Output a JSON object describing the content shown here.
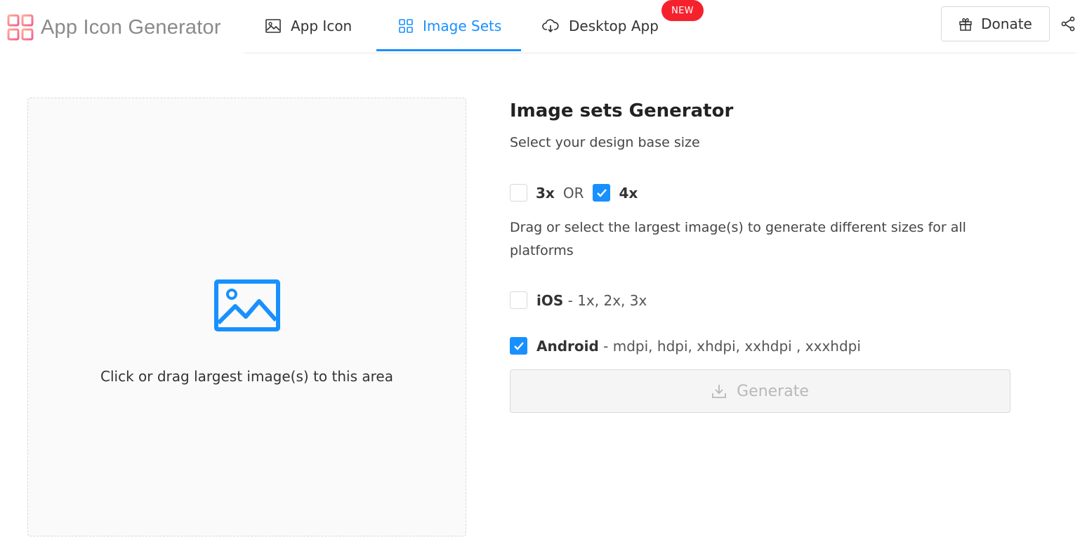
{
  "brand": {
    "name": "App Icon Generator",
    "logo_colors": [
      "#f06292",
      "#ff8a65"
    ]
  },
  "nav": {
    "tabs": [
      {
        "label": "App Icon",
        "icon": "image-icon",
        "active": false
      },
      {
        "label": "Image Sets",
        "icon": "grid-icon",
        "active": true
      },
      {
        "label": "Desktop App",
        "icon": "cloud-download-icon",
        "active": false
      }
    ],
    "badge": "NEW",
    "donate": "Donate",
    "share_icon": "share-icon"
  },
  "upload": {
    "icon": "picture-icon",
    "text": "Click or drag largest image(s) to this area"
  },
  "generator": {
    "title": "Image sets Generator",
    "subtitle": "Select your design base size",
    "base_sizes": [
      {
        "label": "3x",
        "checked": false
      },
      {
        "label": "4x",
        "checked": true
      }
    ],
    "or_text": "OR",
    "description": "Drag or select the largest image(s) to generate different sizes for all platforms",
    "platforms": [
      {
        "name": "iOS",
        "sizes": " - 1x, 2x, 3x",
        "checked": false
      },
      {
        "name": "Android",
        "sizes": " - mdpi, hdpi, xhdpi, xxhdpi , xxxhdpi",
        "checked": true
      }
    ],
    "generate_label": "Generate"
  },
  "colors": {
    "accent": "#1890ff",
    "badge": "#f5222d",
    "disabled": "#f5f5f5"
  }
}
